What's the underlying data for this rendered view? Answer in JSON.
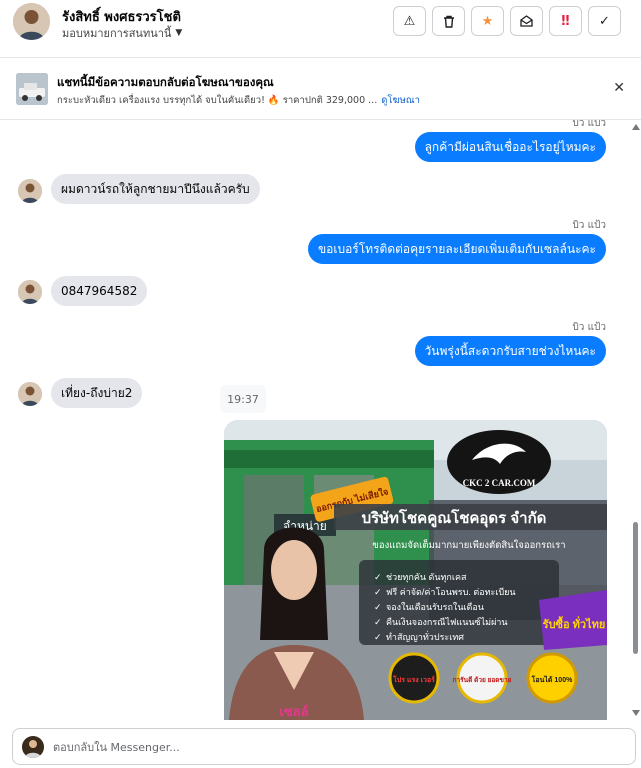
{
  "header": {
    "contact_name": "รังสิทธิ์ พงศธรวรโชติ",
    "assign_label": "มอบหมายการสนทนานี้",
    "actions": [
      {
        "name": "report-spam-button",
        "icon": "warning-icon",
        "glyph": "⚠"
      },
      {
        "name": "delete-button",
        "icon": "trash-icon",
        "glyph": "🗑"
      },
      {
        "name": "star-button",
        "icon": "star-icon",
        "glyph": "★"
      },
      {
        "name": "mark-unread-button",
        "icon": "envelope-open-icon",
        "glyph": "✉"
      },
      {
        "name": "mark-urgent-button",
        "icon": "exclamation-icon",
        "glyph": "‼"
      },
      {
        "name": "mark-done-button",
        "icon": "check-icon",
        "glyph": "✓"
      }
    ]
  },
  "ad_banner": {
    "title": "แชทนี้มีข้อความตอบกลับต่อโฆษณาของคุณ",
    "description": "กระบะหัวเดียว เครื่องแรง บรรทุกได้ จบในคันเดียว! 🔥 ราคาปกติ 329,000 ...",
    "link": "ดูโฆษณา"
  },
  "messages": [
    {
      "direction": "out",
      "sender": "บิว แป้ว",
      "text": "ลูกค้ามีผ่อนสินเชื่ออะไรอยู่ไหมคะ"
    },
    {
      "direction": "in",
      "text": "ผมดาวน์รถให้ลูกชายมาปีนึงแล้วครับ"
    },
    {
      "direction": "out",
      "sender": "บิว แป้ว",
      "text": "ขอเบอร์โทรติดต่อคุยรายละเอียดเพิ่มเติมกับเซลล์นะคะ"
    },
    {
      "direction": "in",
      "text": "0847964582"
    },
    {
      "direction": "out",
      "sender": "บิว แป้ว",
      "text": "วันพรุ่งนี้สะดวกรับสายช่วงไหนคะ"
    },
    {
      "direction": "in",
      "text": "เที่ยง-ถึงบ่าย2"
    }
  ],
  "timestamp": "19:37",
  "ad_image": {
    "logo_text": "CKC 2 CAR.COM",
    "sign_text": "จำหน่าย",
    "sticker_text": "ออกรถกับ ไม่เสียใจ",
    "company": "บริษัทโชคคูณโชคอุดร จำกัด",
    "tagline": "ของแถมจัดเต็มมากมายเพียงตัดสินใจออกรถเรา",
    "bullets": [
      "ช่วยทุกคัน ดันทุกเคส",
      "ฟรี ค่าจัด/ค่าโอนพรบ. ต่อทะเบียน",
      "จองในเดือนรับรถในเดือน",
      "คืนเงินจองกรณีไฟแนนซ์ไม่ผ่าน",
      "ทำสัญญาทั่วประเทศ"
    ],
    "ribbon_text": "รับซื้อ ทั่วไทย",
    "badges": [
      "โปร แรง เวอร์",
      "การันตี ด้วย ยอดขาย",
      "โอนได้ 100%"
    ],
    "shirt_text": "เซลล์"
  },
  "composer": {
    "placeholder": "ตอบกลับใน Messenger..."
  },
  "colors": {
    "outgoing_bubble": "#0a7cff",
    "incoming_bubble": "#e4e6eb",
    "star": "#f7923b",
    "urgent": "#e41e3f"
  }
}
